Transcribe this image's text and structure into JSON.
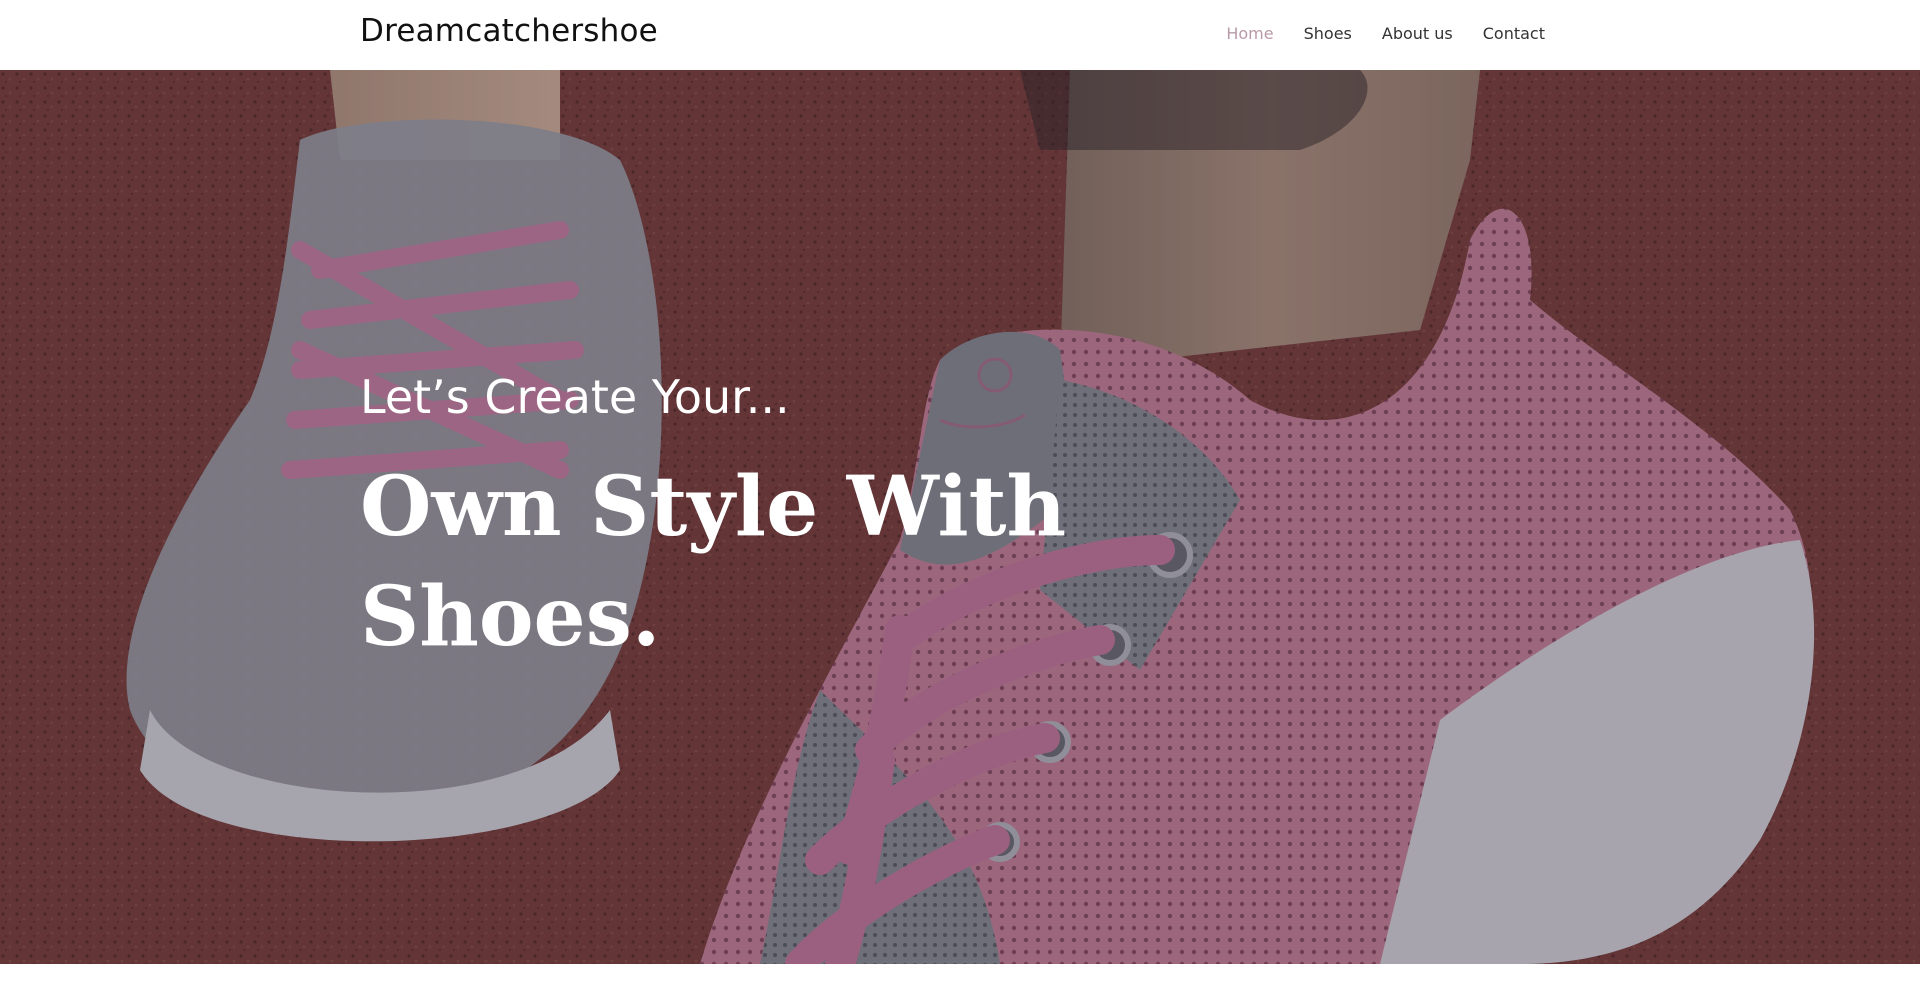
{
  "header": {
    "brand": "Dreamcatchershoe",
    "nav": [
      {
        "label": "Home",
        "active": true
      },
      {
        "label": "Shoes",
        "active": false
      },
      {
        "label": "About us",
        "active": false
      },
      {
        "label": "Contact",
        "active": false
      }
    ]
  },
  "hero": {
    "tagline": "Let’s Create Your...",
    "headline": "Own Style With Shoes.",
    "background_image": "pink-and-grey-knit-sneakers-photo"
  },
  "colors": {
    "nav_active": "#b79aa8",
    "nav_text": "#333333",
    "hero_text": "#ffffff"
  }
}
